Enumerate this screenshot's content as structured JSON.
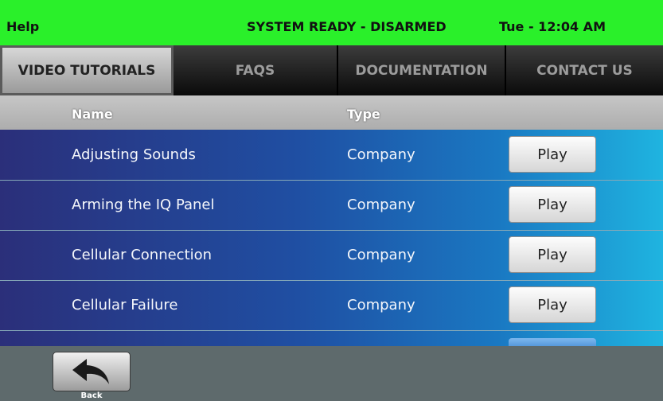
{
  "status_bar": {
    "title": "Help",
    "status": "SYSTEM READY - DISARMED",
    "time": "Tue - 12:04 AM",
    "color": "#2af02a"
  },
  "tabs": [
    {
      "label": "VIDEO TUTORIALS",
      "active": true
    },
    {
      "label": "FAQS",
      "active": false
    },
    {
      "label": "DOCUMENTATION",
      "active": false
    },
    {
      "label": "CONTACT US",
      "active": false
    }
  ],
  "table": {
    "columns": {
      "name": "Name",
      "type": "Type"
    },
    "rows": [
      {
        "name": "Adjusting Sounds",
        "type": "Company",
        "action": "Play"
      },
      {
        "name": "Arming the IQ Panel",
        "type": "Company",
        "action": "Play"
      },
      {
        "name": "Cellular Connection",
        "type": "Company",
        "action": "Play"
      },
      {
        "name": "Cellular Failure",
        "type": "Company",
        "action": "Play"
      }
    ]
  },
  "footer": {
    "back_label": "Back",
    "back_icon": "back-arrow-icon"
  }
}
